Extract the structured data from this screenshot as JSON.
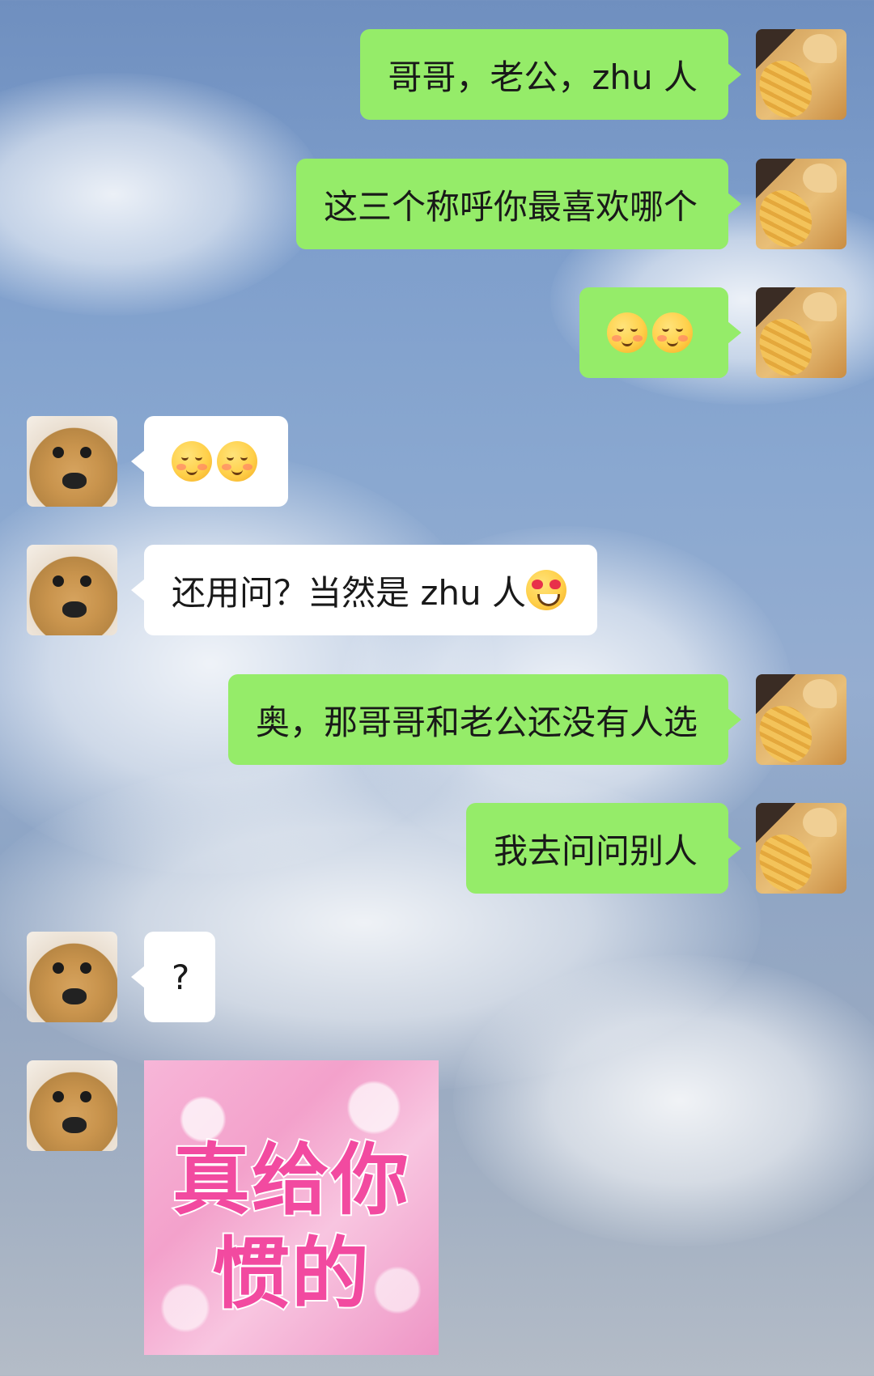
{
  "colors": {
    "outgoing_bubble": "#95ec69",
    "incoming_bubble": "#ffffff",
    "text": "#191919",
    "sticker_text": "#f24aa0"
  },
  "messages": [
    {
      "side": "right",
      "sender": "cat-avatar",
      "text": "哥哥，老公，zhu 人"
    },
    {
      "side": "right",
      "sender": "cat-avatar",
      "text": "这三个称呼你最喜欢哪个"
    },
    {
      "side": "right",
      "sender": "cat-avatar",
      "emoji": [
        "blushing-smile-emoji",
        "blushing-smile-emoji"
      ]
    },
    {
      "side": "left",
      "sender": "dog-avatar",
      "emoji": [
        "pleading-smile-emoji",
        "pleading-smile-emoji"
      ]
    },
    {
      "side": "left",
      "sender": "dog-avatar",
      "text": "还用问？当然是 zhu 人",
      "trailing_emoji": "heart-eyes-emoji"
    },
    {
      "side": "right",
      "sender": "cat-avatar",
      "text": "奥，那哥哥和老公还没有人选"
    },
    {
      "side": "right",
      "sender": "cat-avatar",
      "text": "我去问问别人"
    },
    {
      "side": "left",
      "sender": "dog-avatar",
      "text": "?"
    },
    {
      "side": "left",
      "sender": "dog-avatar",
      "sticker": {
        "line1": "真给你",
        "line2": "惯的"
      }
    }
  ]
}
